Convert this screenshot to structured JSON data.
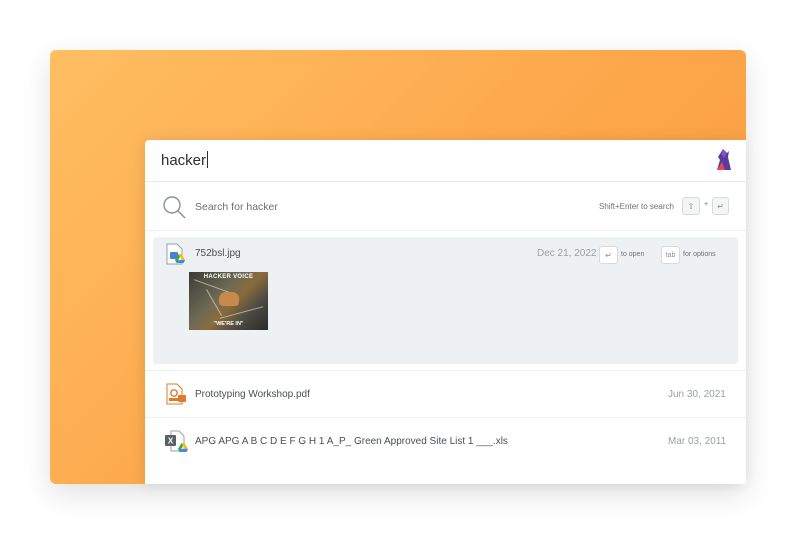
{
  "query": {
    "text": "hacker"
  },
  "search_row": {
    "label": "Search for hacker",
    "hint": "Shift+Enter to search"
  },
  "results": [
    {
      "name": "752bsl.jpg",
      "date": "Dec 21, 2022",
      "open_hint": "to open",
      "options_key": "tab",
      "options_hint": "for options",
      "thumbnail": {
        "top_text": "HACKER VOICE",
        "bottom_text": "\"WE'RE IN\""
      }
    },
    {
      "name": "Prototyping Workshop.pdf",
      "date": "Jun 30, 2021"
    },
    {
      "name": "APG APG A B C D E F G H 1 A_P_ Green Approved Site List 1 ___.xls",
      "date": "Mar 03, 2011"
    }
  ],
  "colors": {
    "background": "#fdac50",
    "panel": "#ffffff",
    "selected_row": "#eef1f3",
    "accent": "#6b3fa0"
  },
  "icons": [
    "search-icon",
    "app-logo-icon",
    "image-file-icon",
    "pdf-file-icon",
    "excel-file-icon",
    "google-drive-icon",
    "shift-key-icon",
    "enter-key-icon"
  ]
}
